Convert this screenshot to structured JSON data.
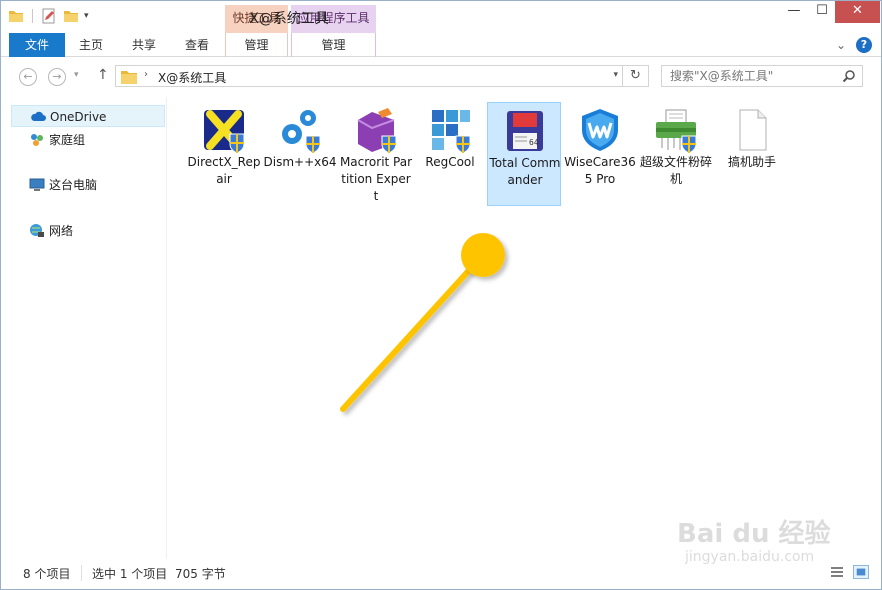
{
  "window": {
    "title": "X@系统工具",
    "minimize_label": "—",
    "maximize_label": "☐",
    "close_label": "✕"
  },
  "ribbon": {
    "context_tabs": [
      "快捷工具",
      "应用程序工具"
    ],
    "tabs": [
      "文件",
      "主页",
      "共享",
      "查看",
      "管理",
      "管理"
    ],
    "expand_label": "⌄",
    "help_label": "?"
  },
  "address": {
    "path": "X@系统工具",
    "search_placeholder": "搜索\"X@系统工具\""
  },
  "nav": {
    "items": [
      {
        "label": "OneDrive",
        "icon": "cloud-icon",
        "selected": true
      },
      {
        "label": "家庭组",
        "icon": "homegroup-icon",
        "selected": false
      },
      {
        "label": "这台电脑",
        "icon": "computer-icon",
        "selected": false
      },
      {
        "label": "网络",
        "icon": "network-icon",
        "selected": false
      }
    ]
  },
  "files": [
    {
      "label": "DirectX_Repair",
      "icon": "directx-repair-icon",
      "selected": false
    },
    {
      "label": "Dism++x64",
      "icon": "dism-icon",
      "selected": false
    },
    {
      "label": "Macrorit Partition Expert",
      "icon": "macrorit-icon",
      "selected": false
    },
    {
      "label": "RegCool",
      "icon": "regcool-icon",
      "selected": false
    },
    {
      "label": "Total Commander",
      "icon": "total-commander-icon",
      "selected": true
    },
    {
      "label": "WiseCare365 Pro",
      "icon": "wisecare-icon",
      "selected": false
    },
    {
      "label": "超级文件粉碎机",
      "icon": "shredder-icon",
      "selected": false
    },
    {
      "label": "搞机助手",
      "icon": "blank-file-icon",
      "selected": false
    }
  ],
  "status": {
    "item_count": "8 个项目",
    "selected": "选中 1 个项目",
    "size": "705 字节"
  },
  "watermark": {
    "main": "Bai du 经验",
    "sub": "jingyan.baidu.com"
  },
  "colors": {
    "file_tab": "#1979ca",
    "quick_tools_tab": "#f7d2c0",
    "app_tools_tab": "#e7d3ef",
    "selection": "#cce8ff",
    "annotation": "#ffc400"
  }
}
